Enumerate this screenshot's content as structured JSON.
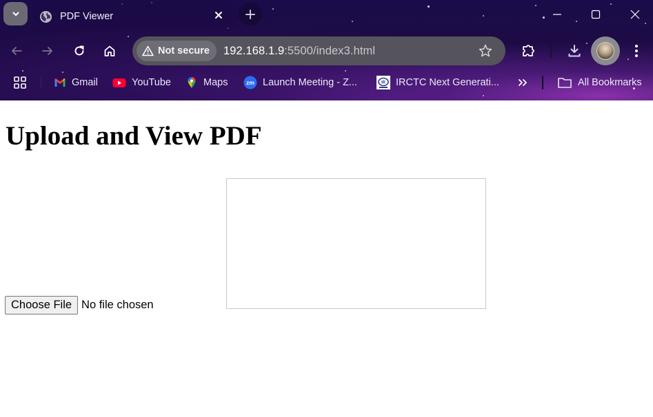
{
  "browser": {
    "tab": {
      "title": "PDF Viewer",
      "favicon": "globe-icon"
    },
    "toolbar": {
      "security_label": "Not secure",
      "url_host": "192.168.1.9",
      "url_rest": ":5500/index3.html",
      "icons": [
        "back-arrow-icon",
        "forward-arrow-icon",
        "reload-icon",
        "home-icon",
        "warning-icon",
        "star-icon",
        "extensions-icon",
        "download-icon",
        "avatar",
        "kebab-menu-icon"
      ]
    },
    "bookmarks": [
      {
        "label": "Gmail",
        "icon": "gmail-icon"
      },
      {
        "label": "YouTube",
        "icon": "youtube-icon"
      },
      {
        "label": "Maps",
        "icon": "maps-icon"
      },
      {
        "label": "Launch Meeting - Z...",
        "icon": "zoom-icon"
      },
      {
        "label": "IRCTC Next Generati...",
        "icon": "irctc-icon"
      }
    ],
    "all_bookmarks_label": "All Bookmarks",
    "colors": {
      "omnibox": "#55545c",
      "chrome_background": "#1d0b45"
    }
  },
  "page": {
    "heading": "Upload and View PDF",
    "file_input": {
      "button_label": "Choose File",
      "status": "No file chosen"
    }
  }
}
